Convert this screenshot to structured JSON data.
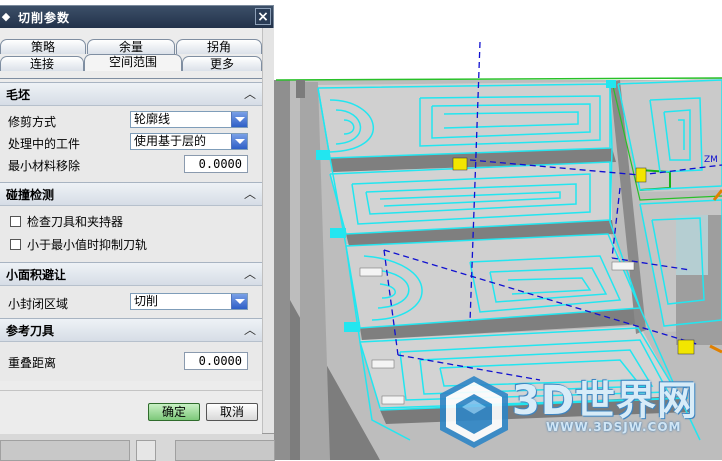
{
  "dialog": {
    "title": "切削参数",
    "tabs_row1": [
      "策略",
      "余量",
      "拐角"
    ],
    "tabs_row2": [
      "连接",
      "空间范围",
      "更多"
    ],
    "active_tab": "空间范围"
  },
  "sections": {
    "blank": {
      "title": "毛坯",
      "trim_label": "修剪方式",
      "trim_value": "轮廓线",
      "ipw_label": "处理中的工件",
      "ipw_value": "使用基于层的",
      "min_removal_label": "最小材料移除",
      "min_removal_value": "0.0000"
    },
    "collision": {
      "title": "碰撞检测",
      "check_holder_label": "检查刀具和夹持器",
      "check_holder_checked": false,
      "suppress_label": "小于最小值时抑制刀轨",
      "suppress_checked": false
    },
    "small_area": {
      "title": "小面积避让",
      "closed_label": "小封闭区域",
      "closed_value": "切削"
    },
    "ref_tool": {
      "title": "参考刀具",
      "overlap_label": "重叠距离",
      "overlap_value": "0.0000"
    }
  },
  "buttons": {
    "ok": "确定",
    "cancel": "取消"
  },
  "viewport": {
    "axis_x": "X",
    "axis_zm": "ZM",
    "watermark": "3D世界网",
    "watermark_url": "WWW.3DSJW.COM"
  },
  "colors": {
    "toolpath": "#22e6f0",
    "path_blue": "#1010d0",
    "part_gray": "#cfcfcf",
    "dark_gray": "#8c8c8c",
    "ok_green": "#7dc87a"
  }
}
